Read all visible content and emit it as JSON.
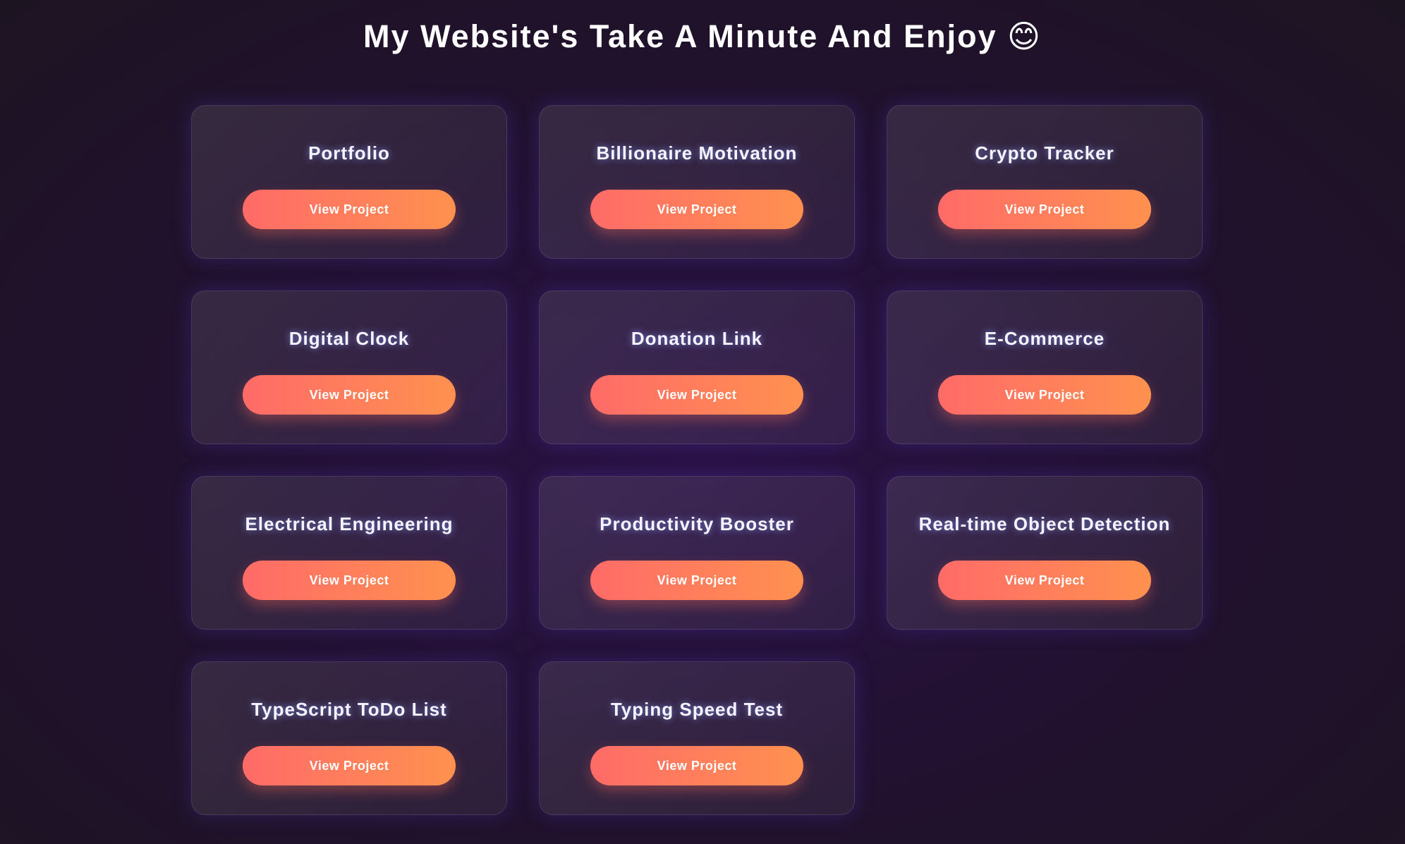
{
  "header": {
    "title": "My Website's Take A Minute And Enjoy 😊"
  },
  "projects": [
    {
      "title": "Portfolio",
      "button_label": "View Project"
    },
    {
      "title": "Billionaire Motivation",
      "button_label": "View Project"
    },
    {
      "title": "Crypto Tracker",
      "button_label": "View Project"
    },
    {
      "title": "Digital Clock",
      "button_label": "View Project"
    },
    {
      "title": "Donation Link",
      "button_label": "View Project"
    },
    {
      "title": "E-Commerce",
      "button_label": "View Project"
    },
    {
      "title": "Electrical Engineering",
      "button_label": "View Project"
    },
    {
      "title": "Productivity Booster",
      "button_label": "View Project"
    },
    {
      "title": "Real-time Object Detection",
      "button_label": "View Project"
    },
    {
      "title": "TypeScript ToDo List",
      "button_label": "View Project"
    },
    {
      "title": "Typing Speed Test",
      "button_label": "View Project"
    }
  ],
  "colors": {
    "background": "#21112e",
    "button_gradient_start": "#ff6b68",
    "button_gradient_end": "#ff914f",
    "title_text": "#ffffff"
  }
}
